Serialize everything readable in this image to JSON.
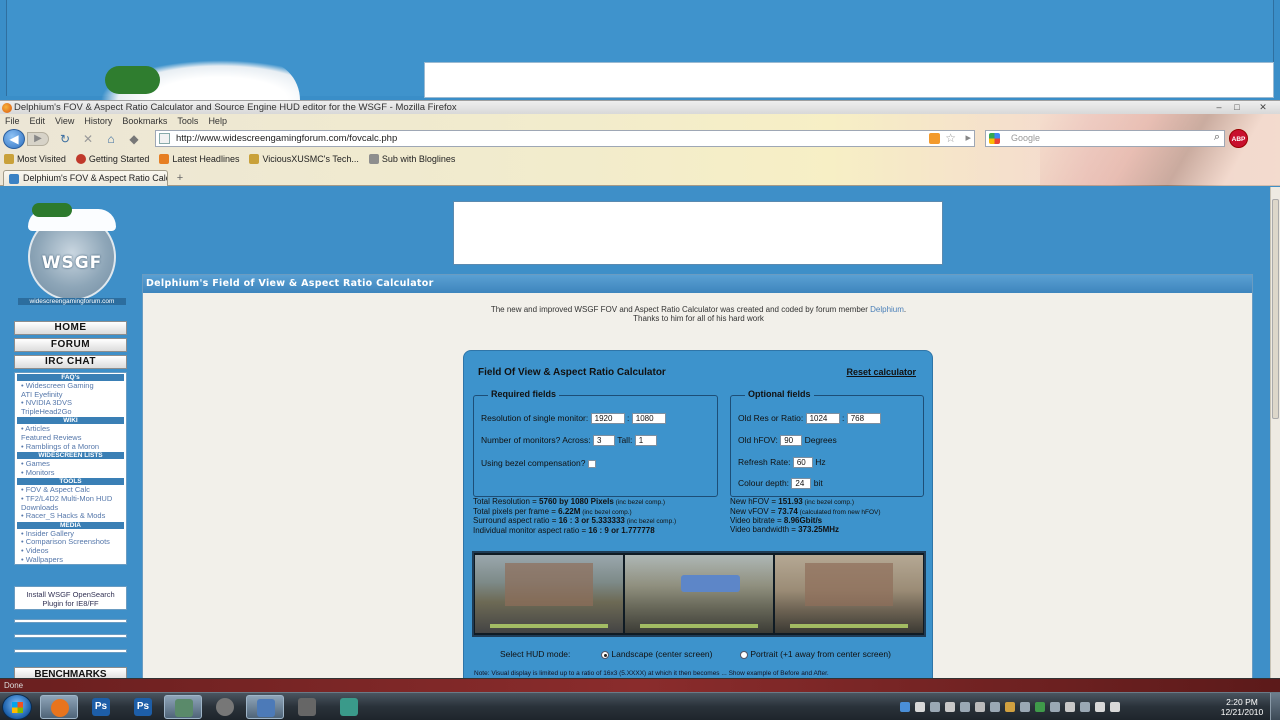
{
  "window": {
    "title": "Delphium's FOV & Aspect Ratio Calculator and Source Engine HUD editor for the WSGF - Mozilla Firefox",
    "controls": [
      "–",
      "□",
      "✕"
    ]
  },
  "menu": [
    "File",
    "Edit",
    "View",
    "History",
    "Bookmarks",
    "Tools",
    "Help"
  ],
  "navigation": {
    "url": "http://www.widescreengamingforum.com/fovcalc.php",
    "search_placeholder": "Google",
    "abp_label": "ABP"
  },
  "bookmarks": [
    {
      "label": "Most Visited",
      "color": "#c9a13a"
    },
    {
      "label": "Getting Started",
      "color": "#c0392b"
    },
    {
      "label": "Latest Headlines",
      "color": "#e67e22"
    },
    {
      "label": "ViciousXUSMC's Tech...",
      "color": "#c0392b"
    },
    {
      "label": "Sub with Bloglines",
      "color": "#8e8e8e"
    }
  ],
  "tab": {
    "label": "Delphium's FOV & Aspect Ratio Calcu...",
    "new_tab": "+"
  },
  "site": {
    "logo_text": "WSGF",
    "logo_caption": "widescreengamingforum.com",
    "big_buttons": [
      "HOME",
      "FORUM",
      "IRC CHAT"
    ],
    "nav_sections": [
      {
        "head": "FAQ's",
        "items": [
          "• Widescreen Gaming",
          "   ATI Eyefinity",
          "• NVIDIA 3DVS",
          "   TripleHead2Go"
        ]
      },
      {
        "head": "WIKI",
        "items": [
          "• Articles",
          "   Featured Reviews",
          "• Ramblings of a Moron"
        ]
      },
      {
        "head": "WIDESCREEN LISTS",
        "items": [
          "• Games",
          "• Monitors"
        ]
      },
      {
        "head": "TOOLS",
        "items": [
          "• FOV & Aspect Calc",
          "• TF2/L4D2 Multi-Mon HUD",
          "   Downloads",
          "• Racer_S Hacks & Mods"
        ]
      },
      {
        "head": "MEDIA",
        "items": [
          "• Insider Gallery",
          "• Comparison Screenshots",
          "• Videos",
          "• Wallpapers"
        ]
      }
    ],
    "search_plugin": "Install WSGF OpenSearch\nPlugin for IE8/FF",
    "benchmarks": "BENCHMARKS"
  },
  "panel": {
    "header": "Delphium's Field of View & Aspect Ratio Calculator",
    "intro_line1": "The new and improved WSGF FOV and Aspect Ratio Calculator was created and coded by forum member ",
    "intro_link": "Delphium",
    "intro_line2": "Thanks to him for all of his hard work"
  },
  "calculator": {
    "title": "Field Of View & Aspect Ratio Calculator",
    "reset": "Reset calculator",
    "required": {
      "legend": "Required fields",
      "resolution_label": "Resolution of single monitor:",
      "res_w": "1920",
      "sep": ":",
      "res_h": "1080",
      "monitors_label": "Number of monitors?  Across:",
      "across": "3",
      "tall_label": "Tall:",
      "tall": "1",
      "bezel_label": "Using bezel compensation?"
    },
    "optional": {
      "legend": "Optional fields",
      "oldres_label": "Old Res or Ratio:",
      "old_w": "1024",
      "old_h": "768",
      "oldfov_label": "Old hFOV:",
      "oldfov": "90",
      "degrees": "Degrees",
      "refresh_label": "Refresh Rate:",
      "refresh": "60",
      "hz": "Hz",
      "depth_label": "Colour depth:",
      "depth": "24",
      "bit": "bit"
    },
    "results_left": [
      {
        "label": "Total Resolution = ",
        "value": "5760 by 1080 Pixels",
        "note": " (inc bezel comp.)"
      },
      {
        "label": "Total pixels per frame = ",
        "value": "6.22M",
        "note": " (inc bezel comp.)"
      },
      {
        "label": "Surround aspect ratio = ",
        "value": "16 : 3 or 5.333333",
        "note": " (inc bezel comp.)"
      },
      {
        "label": "Individual monitor aspect ratio = ",
        "value": "16 : 9 or 1.777778",
        "note": ""
      }
    ],
    "results_right": [
      {
        "label": "New hFOV = ",
        "value": "151.93",
        "note": " (inc bezel comp.)"
      },
      {
        "label": "New vFOV = ",
        "value": "73.74",
        "note": " (calculated from new hFOV)"
      },
      {
        "label": "Video bitrate = ",
        "value": "8.96Gbit/s",
        "note": ""
      },
      {
        "label": "Video bandwidth = ",
        "value": "373.25MHz",
        "note": ""
      }
    ],
    "hud_mode_label": "Select HUD mode:",
    "landscape": "Landscape (center screen)",
    "portrait": "Portrait (+1 away from center screen)",
    "note": "Note: Visual display is limited up to a ratio of 16x3 (5.XXXX) at which it then becomes ... Show example of Before and After."
  },
  "status": "Done",
  "taskbar": {
    "apps": [
      {
        "label": "",
        "color": "#e8741d"
      },
      {
        "label": "Ps",
        "color": "#1d5ea8"
      },
      {
        "label": "Ps",
        "color": "#1d5ea8"
      },
      {
        "label": "",
        "color": "#5a8a6a"
      },
      {
        "label": "",
        "color": "#777"
      },
      {
        "label": "",
        "color": "#4c7ab8"
      },
      {
        "label": "",
        "color": "#666"
      },
      {
        "label": "",
        "color": "#3a9a8a"
      }
    ],
    "time": "2:20 PM",
    "date": "12/21/2010"
  }
}
